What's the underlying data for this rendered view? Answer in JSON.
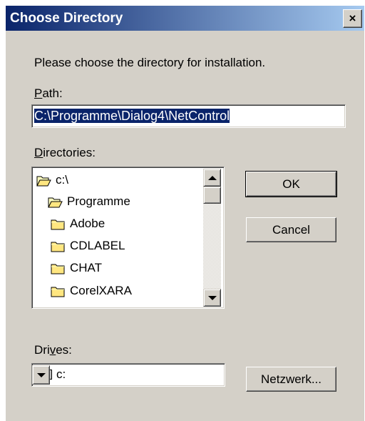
{
  "window": {
    "title": "Choose Directory",
    "close_glyph": "×"
  },
  "instruction": "Please choose the directory for installation.",
  "path": {
    "label_mnemonic": "P",
    "label_rest": "ath:",
    "value": "C:\\Programme\\Dialog4\\NetControl"
  },
  "directories": {
    "label_mnemonic": "D",
    "label_rest": "irectories:",
    "items": [
      {
        "label": "c:\\",
        "icon": "open-folder-icon"
      },
      {
        "label": "Programme",
        "icon": "open-folder-icon"
      },
      {
        "label": "Adobe",
        "icon": "folder-icon"
      },
      {
        "label": "CDLABEL",
        "icon": "folder-icon"
      },
      {
        "label": "CHAT",
        "icon": "folder-icon"
      },
      {
        "label": "CorelXARA",
        "icon": "folder-icon"
      }
    ]
  },
  "drives": {
    "label_before": "Dri",
    "label_mnemonic": "v",
    "label_after": "es:",
    "selected": "c:",
    "icon": "drive-icon"
  },
  "buttons": {
    "ok": "OK",
    "cancel": "Cancel",
    "network": "Netzwerk..."
  },
  "colors": {
    "titlebar_start": "#0a246a",
    "titlebar_end": "#a6caf0",
    "dialog_bg": "#d4d0c8",
    "selection": "#0a246a"
  }
}
